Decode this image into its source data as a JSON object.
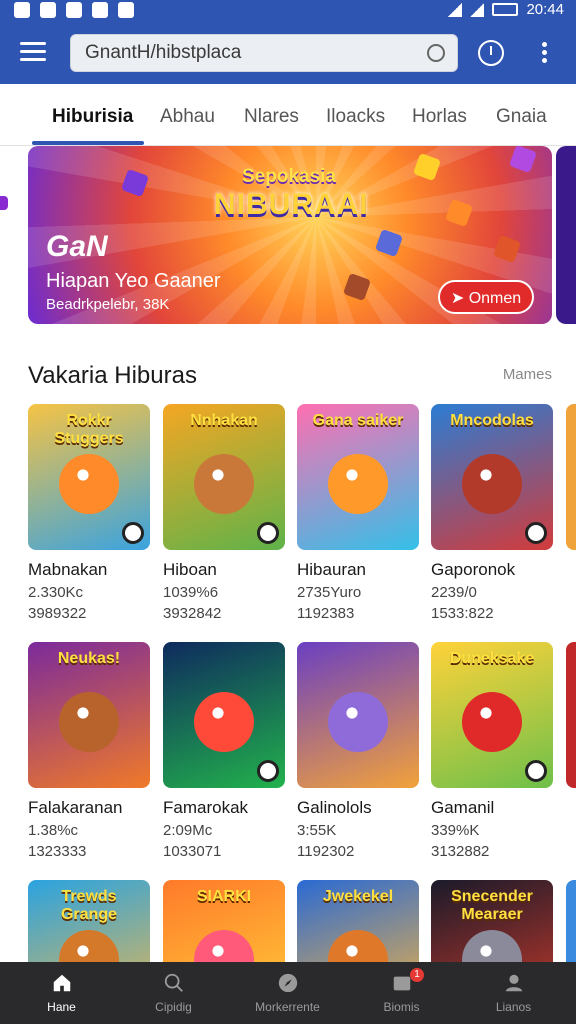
{
  "status_bar": {
    "time": "20:44"
  },
  "search": {
    "value": "GnantH/hibstplaca"
  },
  "tabs": [
    {
      "label": "Hiburisia"
    },
    {
      "label": "Abhau"
    },
    {
      "label": "Nlares"
    },
    {
      "label": "Iloacks"
    },
    {
      "label": "Horlas"
    },
    {
      "label": "Gnaia"
    }
  ],
  "banner": {
    "logo_top": "Sepokasia",
    "logo_main": "NIBURAAI",
    "title": "GaN",
    "subtitle": "Hiapan Yeo Gaaner",
    "meta": "Beadrkpelebr, 38K",
    "button_label": "Onmen"
  },
  "section": {
    "title": "Vakaria Hiburas",
    "more_label": "Mames"
  },
  "games": [
    {
      "art_text": "Rokkr Stuggers",
      "name": "Mabnakan",
      "line1": "2.330Kc",
      "line2": "3989322",
      "colors": [
        "#f6c344",
        "#3aa3e0"
      ],
      "accent": "#ff8a2a"
    },
    {
      "art_text": "Nnhakan",
      "name": "Hiboan",
      "line1": "1039%6",
      "line2": "3932842",
      "colors": [
        "#f5a623",
        "#5fb34a"
      ],
      "accent": "#c9783a"
    },
    {
      "art_text": "Gana saiker",
      "name": "Hibauran",
      "line1": "2735Yuro",
      "line2": "1192383",
      "colors": [
        "#ff6fb1",
        "#33c0e8"
      ],
      "accent": "#ff9a2a"
    },
    {
      "art_text": "Mncodolas",
      "name": "Gaporonok",
      "line1": "2239/0",
      "line2": "1533:822",
      "colors": [
        "#2b7cd3",
        "#d23b3b"
      ],
      "accent": "#b23a2a"
    },
    {
      "art_text": "Neukas!",
      "name": "Falakaranan",
      "line1": "1.38%c",
      "line2": "1323333",
      "colors": [
        "#7b2a9c",
        "#f07a28"
      ],
      "accent": "#b8622c"
    },
    {
      "art_text": "",
      "name": "Famarokak",
      "line1": "2:09Mc",
      "line2": "1033071",
      "colors": [
        "#0e2a5e",
        "#22b24c"
      ],
      "accent": "#ff4a3a"
    },
    {
      "art_text": "",
      "name": "Galinolols",
      "line1": "3:55K",
      "line2": "1192302",
      "colors": [
        "#6a3fc2",
        "#f2a23a"
      ],
      "accent": "#8e6bd9"
    },
    {
      "art_text": "Duneksake",
      "name": "Gamanil",
      "line1": "339%K",
      "line2": "3132882",
      "colors": [
        "#ffd23a",
        "#6ec04a"
      ],
      "accent": "#e02a2a"
    },
    {
      "art_text": "Trewds Grange",
      "name": "",
      "line1": "",
      "line2": "",
      "colors": [
        "#2aa3e0",
        "#f2b84a"
      ],
      "accent": "#d4782a"
    },
    {
      "art_text": "SIARKI",
      "name": "",
      "line1": "",
      "line2": "",
      "colors": [
        "#ff7a2a",
        "#ffd23a"
      ],
      "accent": "#ff5a7a"
    },
    {
      "art_text": "Jwekekel",
      "name": "",
      "line1": "",
      "line2": "",
      "colors": [
        "#2a6ad3",
        "#ffb83a"
      ],
      "accent": "#e0782a"
    },
    {
      "art_text": "Snecender Mearaer",
      "name": "",
      "line1": "",
      "line2": "",
      "colors": [
        "#1a1a2a",
        "#d23b2a"
      ],
      "accent": "#8a8a9a"
    }
  ],
  "bottom_nav": [
    {
      "label": "Hane",
      "icon": "home-icon"
    },
    {
      "label": "Cipidig",
      "icon": "search-icon"
    },
    {
      "label": "Morkerrente",
      "icon": "compass-icon"
    },
    {
      "label": "Biomis",
      "icon": "inbox-icon",
      "badge": "1"
    },
    {
      "label": "Lianos",
      "icon": "profile-icon"
    }
  ],
  "colors": {
    "primary": "#2f55b3",
    "nav_bg": "#2a2a2c",
    "banner_button": "#e12a2a"
  }
}
